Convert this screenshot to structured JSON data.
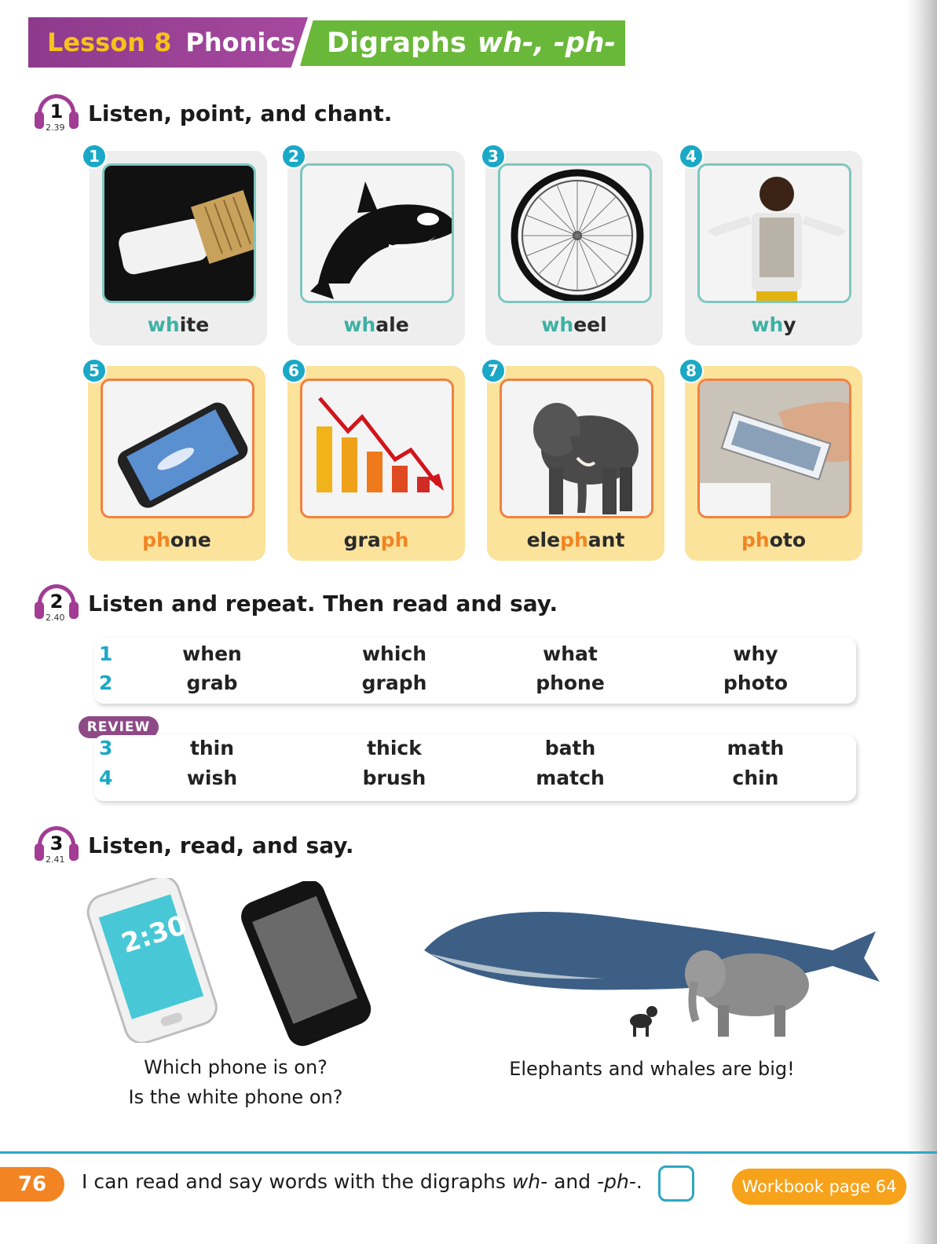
{
  "header": {
    "lesson_label": "Lesson 8",
    "subject_label": "Phonics",
    "topic_prefix": "Digraphs",
    "topic_digraphs": "wh-, -ph-"
  },
  "activities": [
    {
      "number": "1",
      "track": "2.39",
      "title": "Listen, point, and chant."
    },
    {
      "number": "2",
      "track": "2.40",
      "title": "Listen and repeat. Then read and say."
    },
    {
      "number": "3",
      "track": "2.41",
      "title": "Listen, read, and say."
    }
  ],
  "cards": [
    {
      "number": "1",
      "pre": "",
      "hl": "wh",
      "post": "ite",
      "image": "white-paint-brush"
    },
    {
      "number": "2",
      "pre": "",
      "hl": "wh",
      "post": "ale",
      "image": "orca-whale"
    },
    {
      "number": "3",
      "pre": "",
      "hl": "wh",
      "post": "eel",
      "image": "bicycle-wheel"
    },
    {
      "number": "4",
      "pre": "",
      "hl": "wh",
      "post": "y",
      "image": "boy-shrugging"
    },
    {
      "number": "5",
      "pre": "",
      "hl": "ph",
      "post": "one",
      "image": "smartphone"
    },
    {
      "number": "6",
      "pre": "gra",
      "hl": "ph",
      "post": "",
      "image": "falling-bar-graph"
    },
    {
      "number": "7",
      "pre": "ele",
      "hl": "ph",
      "post": "ant",
      "image": "elephant"
    },
    {
      "number": "8",
      "pre": "",
      "hl": "ph",
      "post": "oto",
      "image": "photo-in-hand"
    }
  ],
  "word_rows": [
    {
      "number": "1",
      "words": [
        "when",
        "which",
        "what",
        "why"
      ]
    },
    {
      "number": "2",
      "words": [
        "grab",
        "graph",
        "phone",
        "photo"
      ]
    },
    {
      "number": "3",
      "words": [
        "thin",
        "thick",
        "bath",
        "math"
      ]
    },
    {
      "number": "4",
      "words": [
        "wish",
        "brush",
        "match",
        "chin"
      ]
    }
  ],
  "review_label": "REVIEW",
  "activity3": {
    "phone_screen_time": "2:30",
    "caption_left_1": "Which phone is on?",
    "caption_left_2": "Is the white phone on?",
    "caption_right": "Elephants and whales are big!"
  },
  "footer": {
    "page_number": "76",
    "can_do_prefix": "I can read and say words with the digraphs ",
    "can_do_wh": "wh-",
    "can_do_and": " and ",
    "can_do_ph": "-ph-",
    "can_do_end": ".",
    "workbook": "Workbook page 64"
  },
  "colors": {
    "lesson_banner": "#a6499e",
    "topic_banner": "#6ab83a",
    "wh_highlight": "#3eb1a4",
    "ph_highlight": "#f28423",
    "number_badge": "#1aa8c6"
  }
}
